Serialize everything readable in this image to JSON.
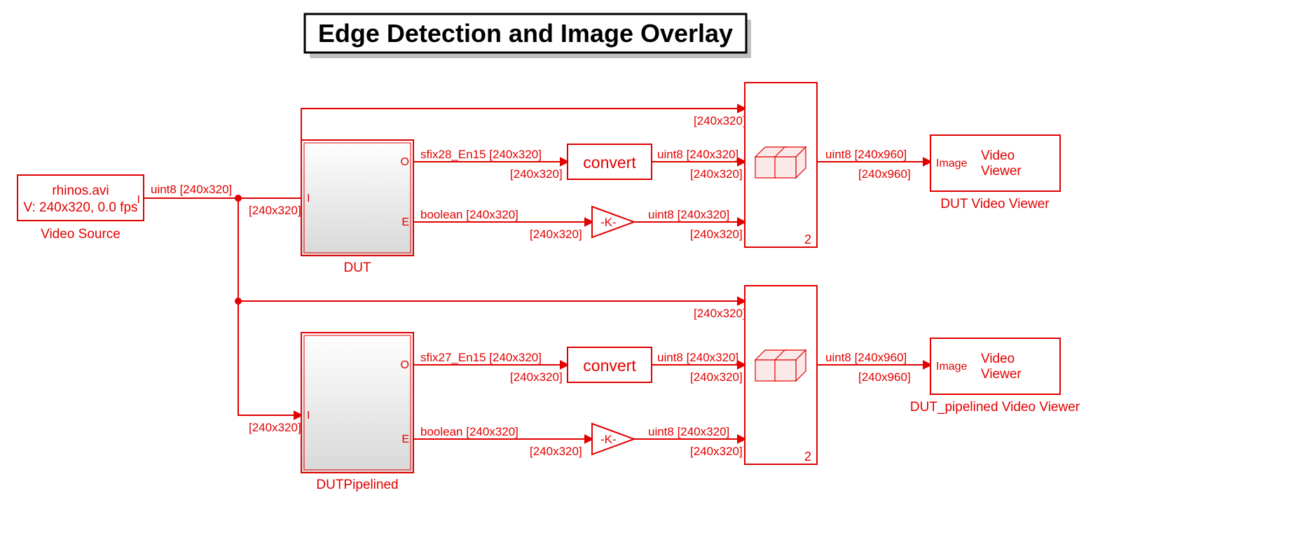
{
  "title": "Edge Detection and Image Overlay",
  "source": {
    "line1": "rhinos.avi",
    "line2": "V: 240x320, 0.0 fps",
    "port_out": "I",
    "name": "Video Source",
    "out_type": "uint8 [240x320]"
  },
  "dut": {
    "name": "DUT",
    "port_in": "I",
    "port_out1": "O",
    "port_out2": "E",
    "in_dim": "[240x320]",
    "o_top": "sfix28_En15 [240x320]",
    "o_bot": "[240x320]",
    "e_top": "boolean [240x320]",
    "e_bot": "[240x320]"
  },
  "dut_pipe": {
    "name": "DUTPipelined",
    "port_in": "I",
    "port_out1": "O",
    "port_out2": "E",
    "in_dim": "[240x320]",
    "o_top": "sfix27_En15 [240x320]",
    "o_bot": "[240x320]",
    "e_top": "boolean [240x320]",
    "e_bot": "[240x320]"
  },
  "convert1": {
    "label": "convert",
    "out_top": "uint8 [240x320]",
    "out_bot": "[240x320]"
  },
  "convert2": {
    "label": "convert",
    "out_top": "uint8 [240x320]",
    "out_bot": "[240x320]"
  },
  "gain1": {
    "label": "-K-",
    "out_top": "uint8 [240x320]",
    "out_bot": "[240x320]"
  },
  "gain2": {
    "label": "-K-",
    "out_top": "uint8 [240x320]",
    "out_bot": "[240x320]"
  },
  "concat1": {
    "dim_in": "[240x320]",
    "idx": "2",
    "out_top": "uint8 [240x960]",
    "out_bot": "[240x960]"
  },
  "concat2": {
    "dim_in": "[240x320]",
    "idx": "2",
    "out_top": "uint8 [240x960]",
    "out_bot": "[240x960]"
  },
  "viewer1": {
    "port": "Image",
    "line1": "Video",
    "line2": "Viewer",
    "name": "DUT Video Viewer"
  },
  "viewer2": {
    "port": "Image",
    "line1": "Video",
    "line2": "Viewer",
    "name": "DUT_pipelined Video Viewer"
  }
}
